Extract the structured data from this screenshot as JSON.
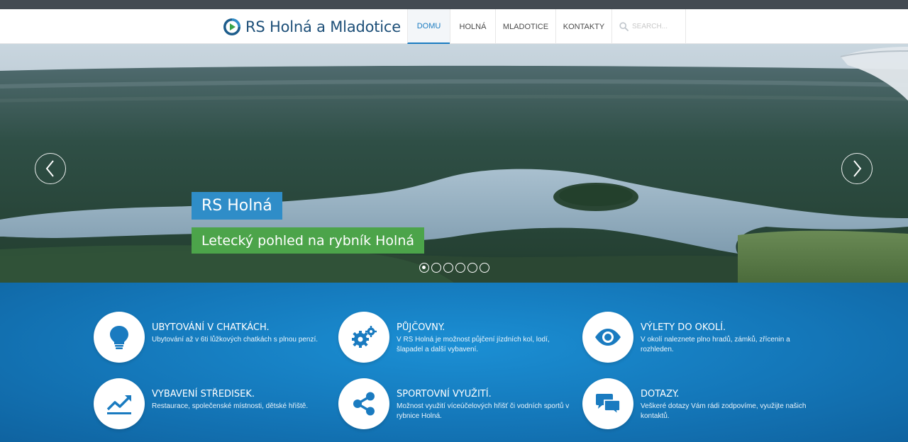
{
  "header": {
    "logo_text": "RS Holná a Mladotice",
    "nav": [
      {
        "label": "DOMU",
        "active": true
      },
      {
        "label": "HOLNÁ",
        "active": false
      },
      {
        "label": "MLADOTICE",
        "active": false
      },
      {
        "label": "KONTAKTY",
        "active": false
      }
    ],
    "search_placeholder": "SEARCH..."
  },
  "slider": {
    "title": "RS Holná",
    "subtitle": "Letecký pohled na rybník Holná",
    "slide_count": 6,
    "active_slide": 1,
    "prev_icon": "chevron-left-icon",
    "next_icon": "chevron-right-icon"
  },
  "features": [
    {
      "icon": "lightbulb-icon",
      "title": "UBYTOVÁNÍ V CHATKÁCH.",
      "text": "Ubytování až v 6ti lůžkových chatkách s plnou penzí."
    },
    {
      "icon": "gears-icon",
      "title": "PŮJČOVNY.",
      "text": "V RS Holná je možnost půjčení jízdních kol, lodí, šlapadel a další vybavení."
    },
    {
      "icon": "eye-icon",
      "title": "VÝLETY DO OKOLÍ.",
      "text": "V okolí naleznete plno hradů, zámků, zřícenin a rozhleden."
    },
    {
      "icon": "trend-chart-icon",
      "title": "VYBAVENÍ STŘEDISEK.",
      "text": "Restaurace, společenské místnosti, dětské hřiště."
    },
    {
      "icon": "share-icon",
      "title": "SPORTOVNÍ VYUŽITÍ.",
      "text": "Možnost využití víceúčelových hřišť či vodních sportů v rybnice Holná."
    },
    {
      "icon": "chat-bubbles-icon",
      "title": "DOTAZY.",
      "text": "Veškeré dotazy Vám rádi zodpovíme, využijte našich kontaktů."
    }
  ],
  "colors": {
    "brand_blue": "#1a7bc0",
    "caption_blue": "#2f8dc8",
    "caption_green": "#4ca44a",
    "features_bg": "#1477b9",
    "topbar": "#434a52"
  }
}
